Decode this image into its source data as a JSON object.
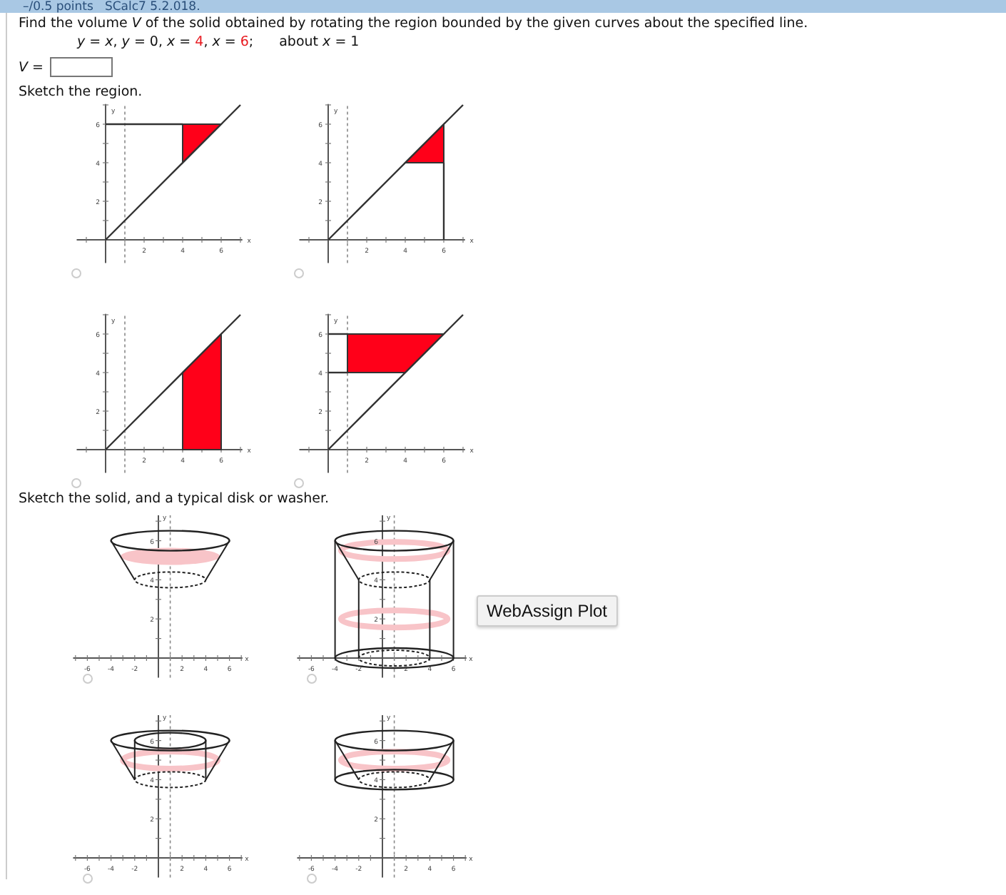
{
  "header": {
    "points": "–/0.5 points",
    "reference": "SCalc7 5.2.018."
  },
  "question": {
    "prompt": "Find the volume *V* of the solid obtained by rotating the region bounded by the given curves about the specified line.",
    "curves": [
      {
        "text": "*y* = *x*, *y* = 0, *x* = ",
        "highlighted": false
      },
      {
        "text": "4",
        "highlighted": true
      },
      {
        "text": ", *x* = ",
        "highlighted": false
      },
      {
        "text": "6",
        "highlighted": true
      },
      {
        "text": ";",
        "highlighted": false
      }
    ],
    "axis": "about *x* = 1"
  },
  "answer": {
    "label": "*V* ="
  },
  "region_section": {
    "instruction": "Sketch the region.",
    "options": [
      {
        "kind": "triangle-left",
        "selected": false,
        "x_label": "x",
        "y_label": "y",
        "x_ticks": [
          "2",
          "4",
          "6"
        ],
        "y_ticks": [
          "6",
          "4",
          "2"
        ]
      },
      {
        "kind": "triangle-right",
        "selected": false,
        "x_label": "x",
        "y_label": "y",
        "x_ticks": [
          "2",
          "4",
          "6"
        ],
        "y_ticks": [
          "6",
          "4",
          "2"
        ]
      },
      {
        "kind": "strip-vertical",
        "selected": false,
        "x_label": "x",
        "y_label": "y",
        "x_ticks": [
          "2",
          "4",
          "6"
        ],
        "y_ticks": [
          "6",
          "4",
          "2"
        ]
      },
      {
        "kind": "strip-horizontal",
        "selected": false,
        "x_label": "x",
        "y_label": "y",
        "x_ticks": [
          "2",
          "4",
          "6"
        ],
        "y_ticks": [
          "6",
          "4",
          "2"
        ]
      }
    ]
  },
  "solid_section": {
    "instruction": "Sketch the solid, and a typical disk or washer.",
    "options": [
      {
        "kind": "frustum",
        "selected": false,
        "x_label": "x",
        "y_label": "y",
        "x_ticks": [
          "-6",
          "-4",
          "-2",
          "2",
          "4",
          "6"
        ],
        "y_ticks": [
          "6",
          "4",
          "2"
        ]
      },
      {
        "kind": "cylinder-frustum-tall",
        "selected": false,
        "x_label": "x",
        "y_label": "y",
        "x_ticks": [
          "-6",
          "-4",
          "-2",
          "2",
          "4",
          "6"
        ],
        "y_ticks": [
          "6",
          "4",
          "2"
        ]
      },
      {
        "kind": "frustum-inner-cylinder",
        "selected": false,
        "x_label": "x",
        "y_label": "y",
        "x_ticks": [
          "-6",
          "-4",
          "-2",
          "2",
          "4",
          "6"
        ],
        "y_ticks": [
          "6",
          "4",
          "2"
        ]
      },
      {
        "kind": "cylinder-frustum",
        "selected": false,
        "x_label": "x",
        "y_label": "y",
        "x_ticks": [
          "-6",
          "-4",
          "-2",
          "2",
          "4",
          "6"
        ],
        "y_ticks": [
          "6",
          "4",
          "2"
        ]
      }
    ],
    "plot_button": "WebAssign Plot"
  }
}
